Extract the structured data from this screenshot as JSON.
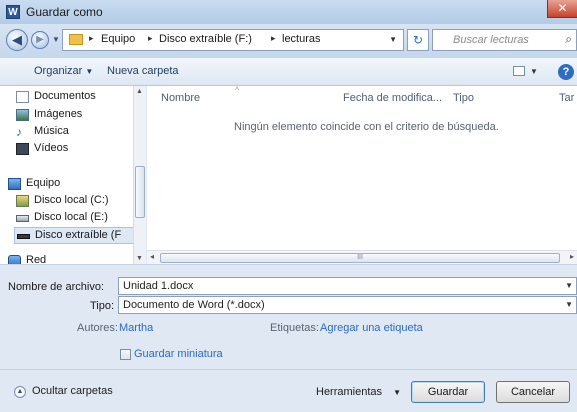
{
  "window": {
    "title": "Guardar como",
    "app_icon_letter": "W",
    "close_symbol": "✕"
  },
  "address": {
    "breadcrumbs": [
      "Equipo",
      "Disco extraíble (F:)",
      "lecturas"
    ],
    "separator": "▸",
    "search_placeholder": "Buscar lecturas"
  },
  "toolbar": {
    "organize_label": "Organizar",
    "new_folder_label": "Nueva carpeta"
  },
  "sidebar": {
    "items": [
      {
        "label": "Documentos",
        "icon": "document-icon"
      },
      {
        "label": "Imágenes",
        "icon": "pictures-icon"
      },
      {
        "label": "Música",
        "icon": "music-icon"
      },
      {
        "label": "Vídeos",
        "icon": "video-icon"
      },
      {
        "label": "Equipo",
        "icon": "computer-icon"
      },
      {
        "label": "Disco local (C:)",
        "icon": "drive-icon"
      },
      {
        "label": "Disco local (E:)",
        "icon": "drive-icon"
      },
      {
        "label": "Disco extraíble (F",
        "icon": "removable-drive-icon",
        "selected": true
      },
      {
        "label": "Red",
        "icon": "network-icon"
      }
    ]
  },
  "file_list": {
    "columns": [
      "Nombre",
      "Fecha de modifica...",
      "Tipo",
      "Tar"
    ],
    "empty_message": "Ningún elemento coincide con el criterio de búsqueda.",
    "scroll_grip": "III"
  },
  "form": {
    "filename_label": "Nombre de archivo:",
    "filename_value": "Unidad 1.docx",
    "type_label": "Tipo:",
    "type_value": "Documento de Word (*.docx)",
    "authors_label": "Autores:",
    "authors_value": "Martha",
    "tags_label": "Etiquetas:",
    "tags_value": "Agregar una etiqueta",
    "thumbnail_label": "Guardar miniatura",
    "thumbnail_checked": false
  },
  "footer": {
    "hide_folders_label": "Ocultar carpetas",
    "tools_label": "Herramientas",
    "save_label": "Guardar",
    "cancel_label": "Cancelar"
  },
  "colors": {
    "accent": "#2a6bc4",
    "title_bg": "#b3cbe6",
    "close_red": "#c4432b"
  }
}
